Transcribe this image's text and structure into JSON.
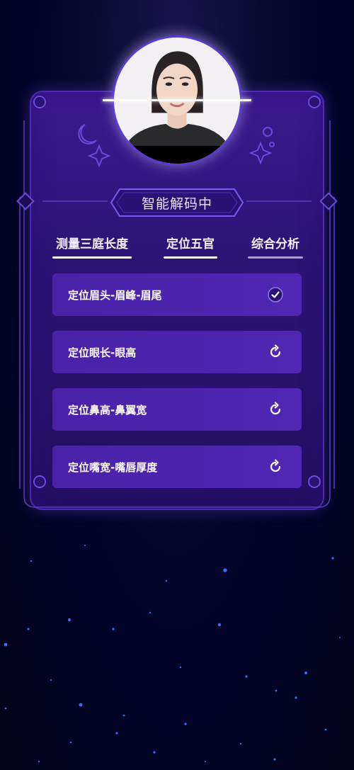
{
  "header": {
    "status_title": "智能解码中"
  },
  "tabs": [
    {
      "label": "测量三庭长度",
      "active": true
    },
    {
      "label": "定位五官",
      "active": true
    },
    {
      "label": "综合分析",
      "active": false
    }
  ],
  "steps": [
    {
      "label": "定位眉头-眉峰-眉尾",
      "state": "done",
      "icon": "check-circle-icon"
    },
    {
      "label": "定位眼长-眼高",
      "state": "loading",
      "icon": "refresh-icon"
    },
    {
      "label": "定位鼻高-鼻翼宽",
      "state": "loading",
      "icon": "refresh-icon"
    },
    {
      "label": "定位嘴宽-嘴唇厚度",
      "state": "loading",
      "icon": "refresh-icon"
    }
  ],
  "colors": {
    "card_bg": "#2c1476",
    "item_bg": "#4a22a8",
    "accent": "#6b4ae0",
    "page_bg": "#04042a"
  }
}
